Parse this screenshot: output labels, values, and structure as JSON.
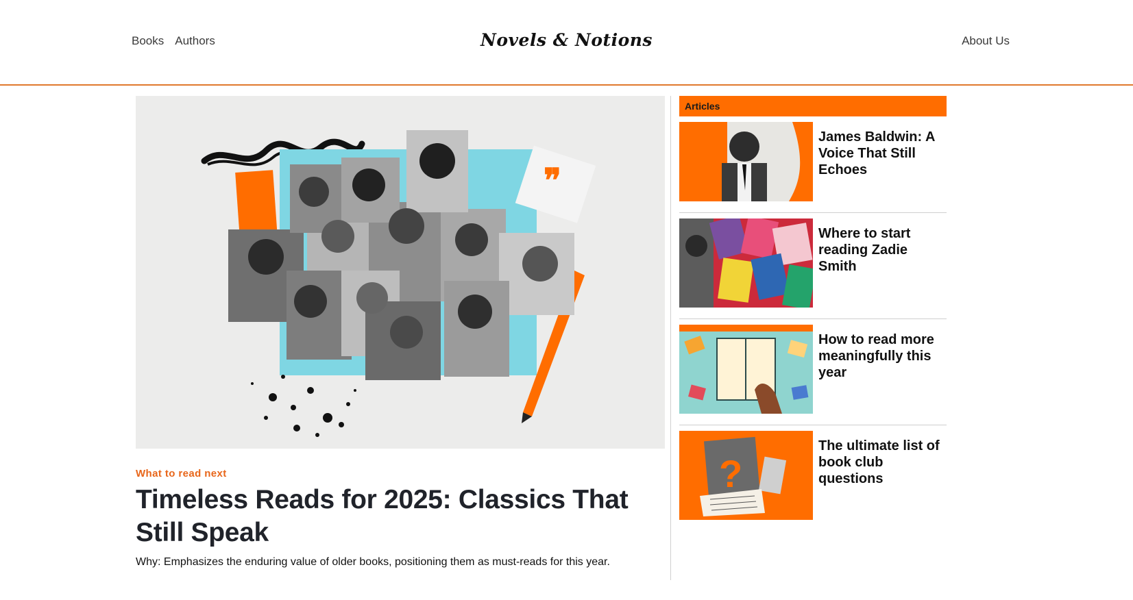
{
  "header": {
    "nav_left": [
      {
        "label": "Books"
      },
      {
        "label": "Authors"
      }
    ],
    "logo": "Novels & Notions",
    "nav_right": {
      "label": "About Us"
    }
  },
  "hero": {
    "kicker": "What to read next",
    "headline": "Timeless Reads for 2025: Classics That Still Speak",
    "dek": "Why: Emphasizes the enduring value of older books, positioning them as must-reads for this year."
  },
  "sidebar": {
    "section_label": "Articles",
    "articles": [
      {
        "title": "James Baldwin: A Voice That Still Echoes"
      },
      {
        "title": "Where to start reading Zadie Smith"
      },
      {
        "title": "How to read more meaningfully this year"
      },
      {
        "title": "The ultimate list of book club questions"
      }
    ]
  },
  "colors": {
    "accent": "#ff6d00",
    "rule": "#e0782d",
    "kicker": "#e8661a"
  }
}
